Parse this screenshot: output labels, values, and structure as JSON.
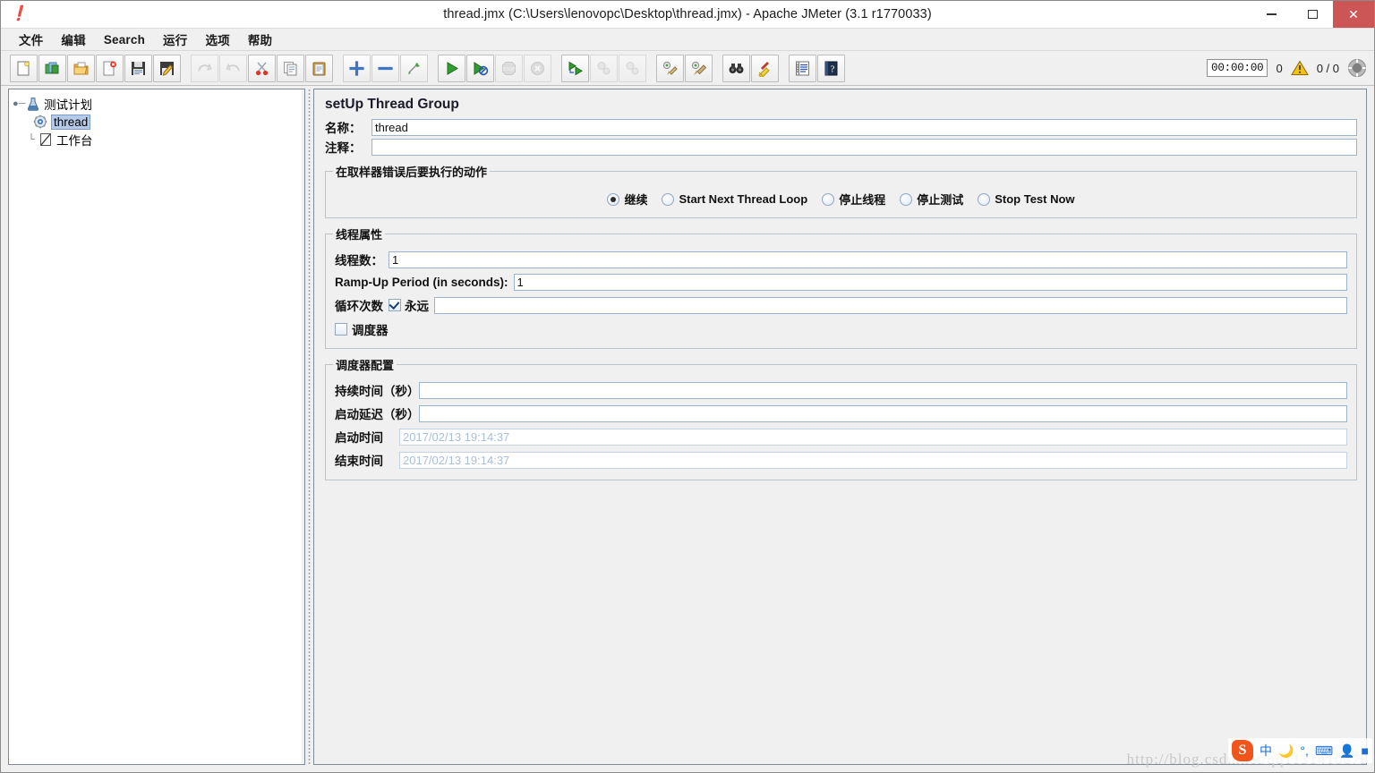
{
  "window": {
    "title": "thread.jmx (C:\\Users\\lenovopc\\Desktop\\thread.jmx) - Apache JMeter (3.1 r1770033)",
    "app_icon": "jmeter-feather-icon",
    "minimize": "–",
    "maximize": "□",
    "close": "✕"
  },
  "menubar": {
    "items": [
      {
        "label": "文件",
        "name": "menu-file"
      },
      {
        "label": "编辑",
        "name": "menu-edit"
      },
      {
        "label": "Search",
        "name": "menu-search"
      },
      {
        "label": "运行",
        "name": "menu-run"
      },
      {
        "label": "选项",
        "name": "menu-options"
      },
      {
        "label": "帮助",
        "name": "menu-help"
      }
    ]
  },
  "toolbar": {
    "buttons": [
      {
        "name": "new-button",
        "icon": "new-document-icon"
      },
      {
        "name": "templates-button",
        "icon": "templates-icon"
      },
      {
        "name": "open-button",
        "icon": "open-folder-icon"
      },
      {
        "name": "close-button",
        "icon": "close-document-icon"
      },
      {
        "name": "save-button",
        "icon": "save-floppy-icon"
      },
      {
        "name": "save-as-button",
        "icon": "save-as-icon"
      },
      {
        "name": "undo-button",
        "icon": "undo-arrow-icon"
      },
      {
        "name": "redo-button",
        "icon": "redo-arrow-icon"
      },
      {
        "name": "cut-button",
        "icon": "scissors-icon"
      },
      {
        "name": "copy-button",
        "icon": "copy-icon"
      },
      {
        "name": "paste-button",
        "icon": "clipboard-paste-icon"
      },
      {
        "name": "expand-all-button",
        "icon": "plus-icon"
      },
      {
        "name": "collapse-all-button",
        "icon": "minus-icon"
      },
      {
        "name": "toggle-button",
        "icon": "toggle-pin-icon"
      },
      {
        "name": "start-button",
        "icon": "play-green-icon"
      },
      {
        "name": "start-no-pauses-button",
        "icon": "play-no-pause-icon"
      },
      {
        "name": "stop-button",
        "icon": "stop-sign-icon"
      },
      {
        "name": "shutdown-button",
        "icon": "shutdown-circle-icon"
      },
      {
        "name": "start-remote-button",
        "icon": "remote-start-icon"
      },
      {
        "name": "stop-remote-button",
        "icon": "remote-stop-icon"
      },
      {
        "name": "shutdown-remote-button",
        "icon": "remote-shutdown-icon"
      },
      {
        "name": "clear-button",
        "icon": "clear-broom-icon"
      },
      {
        "name": "clear-all-button",
        "icon": "clear-all-broom-icon"
      },
      {
        "name": "search-button",
        "icon": "binoculars-icon"
      },
      {
        "name": "reset-search-button",
        "icon": "broom-yellow-icon"
      },
      {
        "name": "function-helper-button",
        "icon": "function-list-icon"
      },
      {
        "name": "help-button",
        "icon": "help-book-icon"
      }
    ],
    "status": {
      "elapsed_time": "00:00:00",
      "warning_count": "0",
      "warning_icon": "warning-triangle-icon",
      "thread_counts": "0 / 0",
      "remote_icon": "connection-status-icon"
    }
  },
  "tree": {
    "nodes": [
      {
        "label": "测试计划",
        "icon": "test-plan-icon",
        "selected": false,
        "name": "tree-node-test-plan"
      },
      {
        "label": "thread",
        "icon": "thread-group-gear-icon",
        "selected": true,
        "name": "tree-node-thread"
      },
      {
        "label": "工作台",
        "icon": "workbench-icon",
        "selected": false,
        "name": "tree-node-workbench"
      }
    ]
  },
  "main": {
    "title": "setUp Thread Group",
    "name_label": "名称：",
    "name_value": "thread",
    "comments_label": "注释：",
    "comments_value": "",
    "error_action": {
      "legend": "在取样器错误后要执行的动作",
      "options": [
        {
          "label": "继续",
          "selected": true,
          "name": "radio-continue"
        },
        {
          "label": "Start Next Thread Loop",
          "selected": false,
          "name": "radio-start-next-thread-loop"
        },
        {
          "label": "停止线程",
          "selected": false,
          "name": "radio-stop-thread"
        },
        {
          "label": "停止测试",
          "selected": false,
          "name": "radio-stop-test"
        },
        {
          "label": "Stop Test Now",
          "selected": false,
          "name": "radio-stop-test-now"
        }
      ]
    },
    "thread_properties": {
      "legend": "线程属性",
      "num_threads_label": "线程数：",
      "num_threads_value": "1",
      "ramp_up_label": "Ramp-Up Period (in seconds):",
      "ramp_up_value": "1",
      "loop_count_label": "循环次数",
      "forever_label": "永远",
      "forever_checked": true,
      "loop_count_value": "",
      "scheduler_label": "调度器",
      "scheduler_checked": false
    },
    "scheduler_config": {
      "legend": "调度器配置",
      "duration_label": "持续时间（秒）",
      "duration_value": "",
      "startup_delay_label": "启动延迟（秒）",
      "startup_delay_value": "",
      "start_time_label": "启动时间",
      "start_time_value": "2017/02/13 19:14:37",
      "end_time_label": "结束时间",
      "end_time_value": "2017/02/13 19:14:37"
    }
  },
  "ime": {
    "logo": "S",
    "mode": "中",
    "moon_icon": "moon-icon",
    "punct_icon": "punctuation-icon",
    "keyboard_icon": "keyboard-icon",
    "user_icon": "user-panel-icon",
    "toolbox_icon": "toolbox-icon"
  },
  "watermark": "http://blog.csdn.net/qq1131410679",
  "colors": {
    "accent": "#b5cbe8",
    "close_button": "#cc5555",
    "background": "#f0f0f0",
    "field_border": "#9bb3cc",
    "ghost_text": "#a8c0da"
  }
}
